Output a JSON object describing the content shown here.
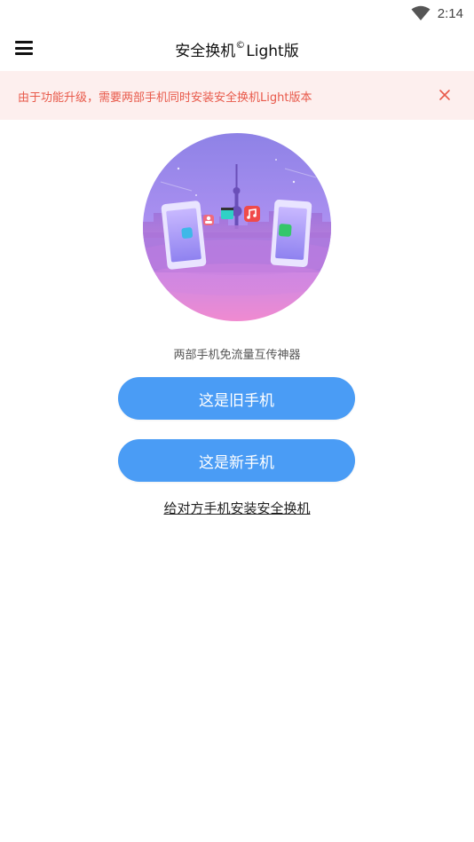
{
  "status_bar": {
    "time": "2:14",
    "wifi_icon": "wifi-icon"
  },
  "app_bar": {
    "menu_icon": "menu-icon",
    "title_prefix": "安全换机",
    "title_mark": "©",
    "title_suffix": "Light版"
  },
  "notice": {
    "text": "由于功能升级，需要两部手机同时安装安全换机Light版本",
    "close_icon": "close-icon",
    "text_color": "#e8594a",
    "bg_color": "#fdefee"
  },
  "hero": {
    "illustration": "phone-transfer-illustration"
  },
  "main": {
    "subtitle": "两部手机免流量互传神器",
    "old_phone_button": "这是旧手机",
    "new_phone_button": "这是新手机",
    "install_link": "给对方手机安装安全换机",
    "accent": "#4a9cf5"
  }
}
